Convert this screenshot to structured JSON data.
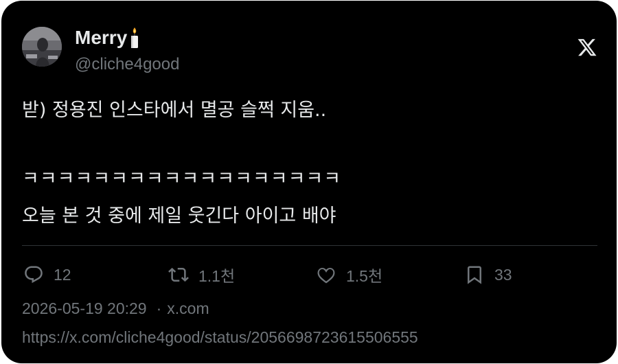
{
  "author": {
    "name": "Merry",
    "emoji_icon": "candle-icon",
    "handle": "@cliche4good"
  },
  "brand_icon": "x-logo-icon",
  "tweet": {
    "line1": "받) 정용진 인스타에서 멸공 슬쩍 지움..",
    "line3": "ㅋㅋㅋㅋㅋㅋㅋㅋㅋㅋㅋㅋㅋㅋㅋㅋㅋㅋ",
    "line4": "오늘 본 것 중에 제일 웃긴다 아이고 배야"
  },
  "actions": {
    "reply_count": "12",
    "retweet_count": "1.1천",
    "like_count": "1.5천",
    "bookmark_count": "33"
  },
  "meta": {
    "timestamp": "2026-05-19 20:29",
    "separator": "·",
    "source": "x.com"
  },
  "url": "https://x.com/cliche4good/status/2056698723615506555",
  "colors": {
    "background": "#000000",
    "text": "#e7e9ea",
    "muted": "#71767b",
    "divider": "#2f3336"
  }
}
